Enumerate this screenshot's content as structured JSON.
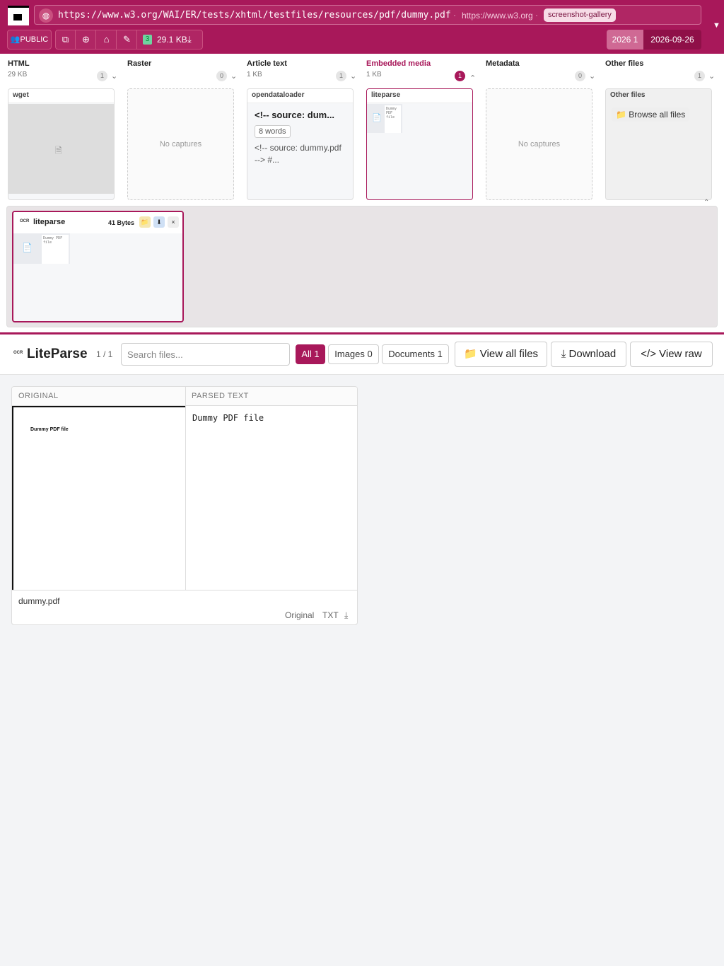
{
  "header": {
    "url": "https://www.w3.org/WAI/ER/tests/xhtml/testfiles/resources/pdf/dummy.pdf",
    "host": "https://www.w3.org",
    "tag": "screenshot-gallery",
    "visibility": "👥PUBLIC",
    "snapshot_count": "3",
    "total_size": "29.1 KB",
    "year": "2026 1",
    "date": "2026-09-26"
  },
  "categories": [
    {
      "title": "HTML",
      "size": "29 KB",
      "count": "1",
      "card_title": "wget"
    },
    {
      "title": "Raster",
      "size": "",
      "count": "0",
      "empty": "No captures"
    },
    {
      "title": "Article text",
      "size": "1 KB",
      "count": "1",
      "card_title": "opendataloader",
      "headline": "<!-- source: dum...",
      "words": "8 words",
      "snippet": "<!-- source: dummy.pdf --> #..."
    },
    {
      "title": "Embedded media",
      "size": "1 KB",
      "count": "1",
      "card_title": "liteparse",
      "thumb_text": "Dummy PDF file"
    },
    {
      "title": "Metadata",
      "size": "",
      "count": "0",
      "empty": "No captures"
    },
    {
      "title": "Other files",
      "size": "",
      "count": "1",
      "card_title": "Other files",
      "browse": "📁 Browse all files"
    }
  ],
  "tray": {
    "ocr": "OCR",
    "name": "liteparse",
    "size": "41 Bytes",
    "thumb_text": "Dummy PDF file"
  },
  "viewer": {
    "ocr": "OCR",
    "title": "LiteParse",
    "count": "1 / 1",
    "search_placeholder": "Search files...",
    "filters": [
      "All 1",
      "Images 0",
      "Documents 1"
    ],
    "view_all": "📁 View all files",
    "download": "⤓ Download",
    "view_raw": "</> View raw"
  },
  "result": {
    "original_header": "ORIGINAL",
    "parsed_header": "PARSED TEXT",
    "original_text": "Dummy PDF file",
    "parsed_text": "Dummy PDF file",
    "filename": "dummy.pdf",
    "link_original": "Original",
    "link_txt": "TXT",
    "link_download": "⤓"
  },
  "colors": {
    "brand": "#a8185a",
    "accent_light": "#cf6994",
    "background": "#f3f4f6"
  }
}
